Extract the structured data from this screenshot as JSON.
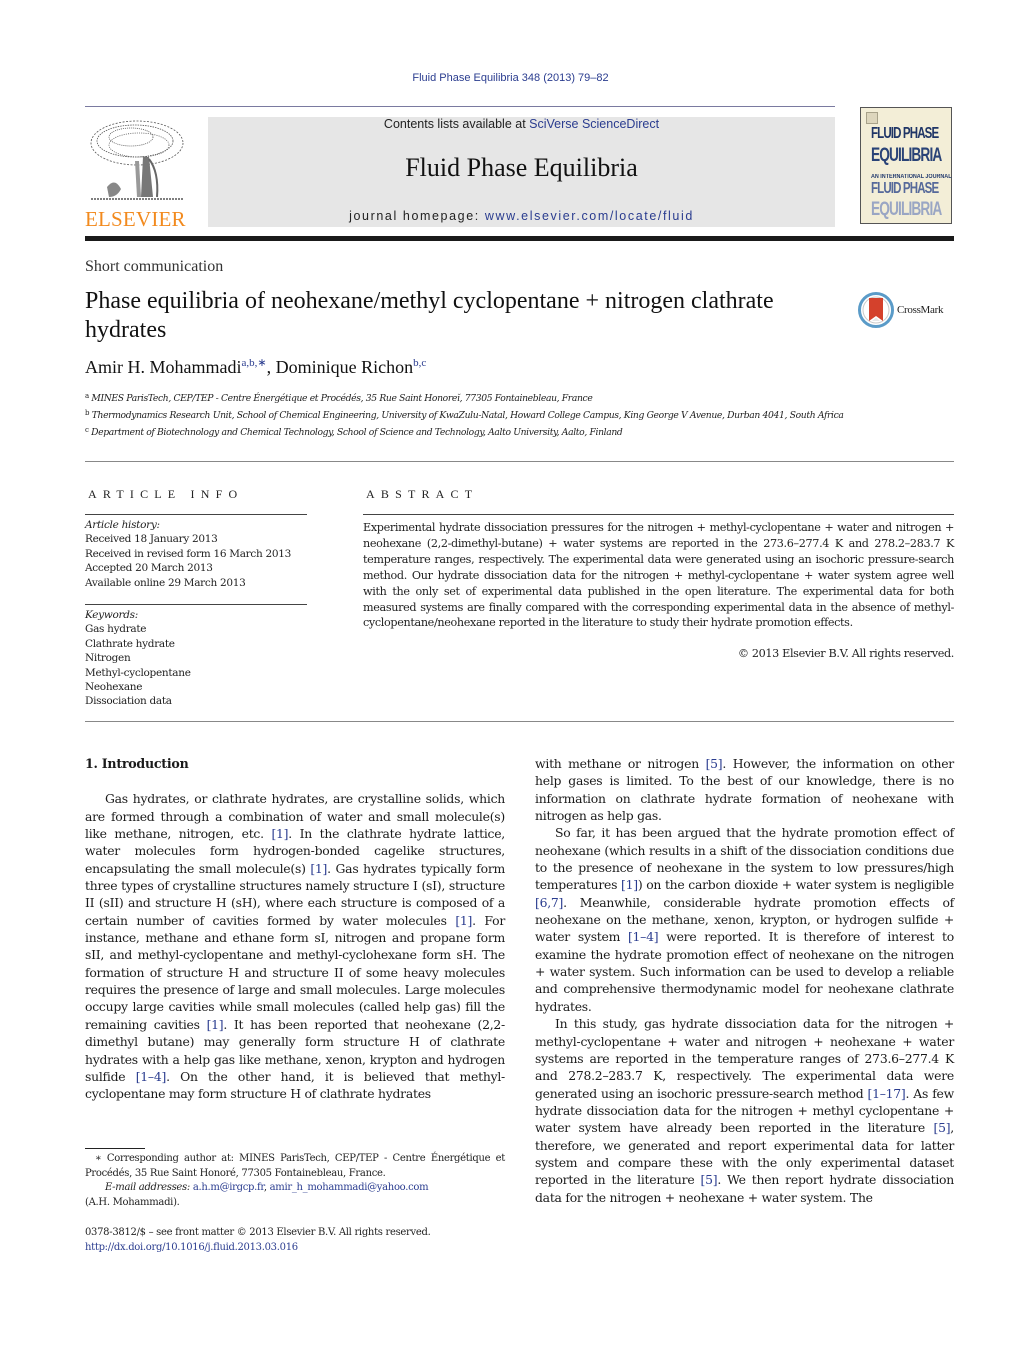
{
  "header": {
    "citation": "Fluid Phase Equilibria 348 (2013) 79–82",
    "publisher_logo": "ELSEVIER",
    "contents_prefix": "Contents lists available at ",
    "contents_link": "SciVerse ScienceDirect",
    "journal_name": "Fluid Phase Equilibria",
    "homepage_prefix": "journal homepage: ",
    "homepage_link": "www.elsevier.com/locate/fluid",
    "cover": {
      "line1": "FLUID PHASE",
      "line2": "EQUILIBRIA",
      "subtitle": "AN INTERNATIONAL JOURNAL",
      "line3": "FLUID PHASE",
      "line4": "EQUILIBRIA"
    },
    "colors": {
      "link": "#2a3c8f",
      "elsevier_orange": "#f28a1e",
      "banner_bg": "#e6e6e6"
    }
  },
  "article": {
    "section_type": "Short communication",
    "title": "Phase equilibria of neohexane/methyl cyclopentane + nitrogen clathrate hydrates",
    "crossmark_label": "CrossMark",
    "authors": [
      {
        "name": "Amir H. Mohammadi",
        "sup": "a,b,∗"
      },
      {
        "name": "Dominique Richon",
        "sup": "b,c"
      }
    ],
    "affiliations": [
      {
        "key": "a",
        "text": "MINES ParisTech, CEP/TEP - Centre Énergétique et Procédés, 35 Rue Saint Honoreĭ, 77305 Fontainebleau, France"
      },
      {
        "key": "b",
        "text": "Thermodynamics Research Unit, School of Chemical Engineering, University of KwaZulu-Natal, Howard College Campus, King George V Avenue, Durban 4041, South Africa"
      },
      {
        "key": "c",
        "text": "Department of Biotechnology and Chemical Technology, School of Science and Technology, Aalto University, Aalto, Finland"
      }
    ]
  },
  "article_info": {
    "heading": "ARTICLE INFO",
    "history_label": "Article history:",
    "history": [
      "Received 18 January 2013",
      "Received in revised form 16 March 2013",
      "Accepted 20 March 2013",
      "Available online 29 March 2013"
    ],
    "keywords_label": "Keywords:",
    "keywords": [
      "Gas hydrate",
      "Clathrate hydrate",
      "Nitrogen",
      "Methyl-cyclopentane",
      "Neohexane",
      "Dissociation data"
    ]
  },
  "abstract": {
    "heading": "ABSTRACT",
    "text": "Experimental hydrate dissociation pressures for the nitrogen + methyl-cyclopentane + water and nitrogen + neohexane (2,2-dimethyl-butane) + water systems are reported in the 273.6–277.4 K and 278.2–283.7 K temperature ranges, respectively. The experimental data were generated using an isochoric pressure-search method. Our hydrate dissociation data for the nitrogen + methyl-cyclopentane + water system agree well with the only set of experimental data published in the open literature. The experimental data for both measured systems are finally compared with the corresponding experimental data in the absence of methyl-cyclopentane/neohexane reported in the literature to study their hydrate promotion effects.",
    "copyright": "© 2013 Elsevier B.V. All rights reserved."
  },
  "body": {
    "section_heading": "1.  Introduction",
    "left_paragraph": [
      {
        "t": "Gas hydrates, or clathrate hydrates, are crystalline solids, which are formed through a combination of water and small molecule(s) like methane, nitrogen, etc. "
      },
      {
        "r": "[1]"
      },
      {
        "t": ". In the clathrate hydrate lattice, water molecules form hydrogen-bonded cagelike structures, encapsulating the small molecule(s) "
      },
      {
        "r": "[1]"
      },
      {
        "t": ". Gas hydrates typically form three types of crystalline structures namely structure I (sI), structure II (sII) and structure H (sH), where each structure is composed of a certain number of cavities formed by water molecules "
      },
      {
        "r": "[1]"
      },
      {
        "t": ". For instance, methane and ethane form sI, nitrogen and propane form sII, and methyl-cyclopentane and methyl-cyclohexane form sH. The formation of structure H and structure II of some heavy molecules requires the presence of large and small molecules. Large molecules occupy large cavities while small molecules (called help gas) fill the remaining cavities "
      },
      {
        "r": "[1]"
      },
      {
        "t": ". It has been reported that neohexane (2,2-dimethyl butane) may generally form structure H of clathrate hydrates with a help gas like methane, xenon, krypton and hydrogen sulfide "
      },
      {
        "r": "[1–4]"
      },
      {
        "t": ". On the other hand, it is believed that methyl-cyclopentane may form structure H of clathrate hydrates"
      }
    ],
    "right_paragraphs": [
      [
        {
          "t": "with methane or nitrogen "
        },
        {
          "r": "[5]"
        },
        {
          "t": ". However, the information on other help gases is limited. To the best of our knowledge, there is no information on clathrate hydrate formation of neohexane with nitrogen as help gas."
        }
      ],
      [
        {
          "t": "So far, it has been argued that the hydrate promotion effect of neohexane (which results in a shift of the dissociation conditions due to the presence of neohexane in the system to low pressures/high temperatures "
        },
        {
          "r": "[1]"
        },
        {
          "t": ") on the carbon dioxide + water system is negligible "
        },
        {
          "r": "[6,7]"
        },
        {
          "t": ". Meanwhile, considerable hydrate promotion effects of neohexane on the methane, xenon, krypton, or hydrogen sulfide + water system "
        },
        {
          "r": "[1–4]"
        },
        {
          "t": " were reported. It is therefore of interest to examine the hydrate promotion effect of neohexane on the nitrogen + water system. Such information can be used to develop a reliable and comprehensive thermodynamic model for neohexane clathrate hydrates."
        }
      ],
      [
        {
          "t": "In this study, gas hydrate dissociation data for the nitrogen + methyl-cyclopentane + water and nitrogen + neohexane + water systems are reported in the temperature ranges of 273.6–277.4 K and 278.2–283.7 K, respectively. The experimental data were generated using an isochoric pressure-search method "
        },
        {
          "r": "[1–17]"
        },
        {
          "t": ". As few hydrate dissociation data for the nitrogen + methyl cyclopentane + water system have already been reported in the literature "
        },
        {
          "r": "[5]"
        },
        {
          "t": ", therefore, we generated and report experimental data for latter system and compare these with the only experimental dataset reported in the literature "
        },
        {
          "r": "[5]"
        },
        {
          "t": ". We then report hydrate dissociation data for the nitrogen + neohexane + water system. The"
        }
      ]
    ]
  },
  "footnote": {
    "star": "∗",
    "corresponding": " Corresponding author at: MINES ParisTech, CEP/TEP - Centre Énergétique et Procédés, 35 Rue Saint Honoré, 77305 Fontainebleau, France.",
    "email_label": "E-mail addresses:",
    "emails": [
      "a.h.m@irgcp.fr",
      "amir_h_mohammadi@yahoo.com"
    ],
    "email_owner": "(A.H. Mohammadi)."
  },
  "front_matter": {
    "issn_line": "0378-3812/$ – see front matter © 2013 Elsevier B.V. All rights reserved.",
    "doi": "http://dx.doi.org/10.1016/j.fluid.2013.03.016"
  }
}
